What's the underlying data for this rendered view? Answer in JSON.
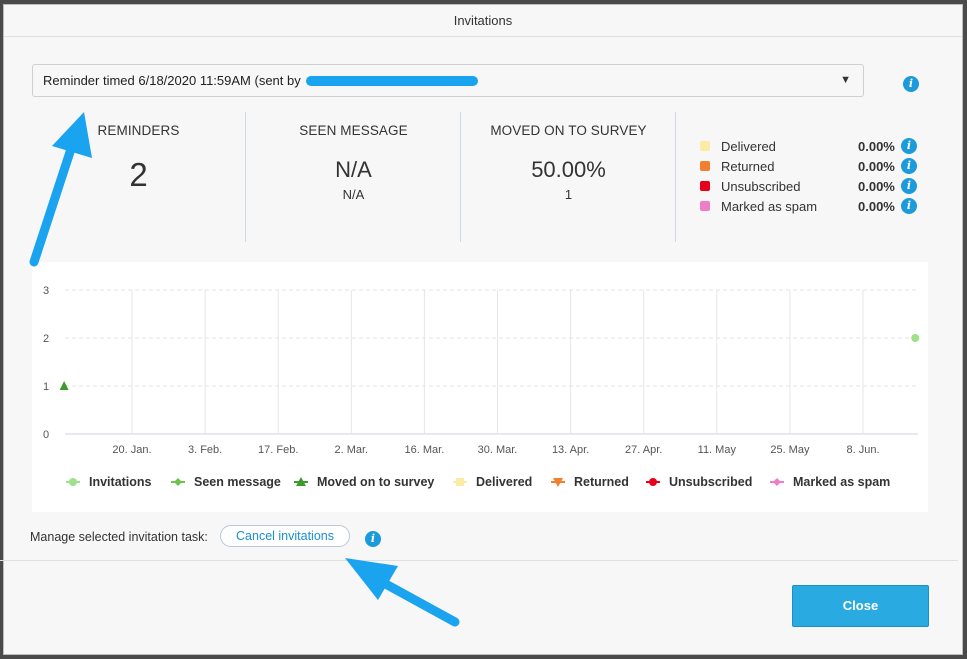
{
  "dialog": {
    "title": "Invitations"
  },
  "reminder_select": {
    "selected_prefix": "Reminder timed 6/18/2020 11:59AM (sent by"
  },
  "stats": {
    "reminders": {
      "label": "REMINDERS",
      "value": "2"
    },
    "seen_message": {
      "label": "SEEN MESSAGE",
      "value": "N/A",
      "sub": "N/A"
    },
    "moved_on": {
      "label": "MOVED ON TO SURVEY",
      "value": "50.00%",
      "sub": "1"
    }
  },
  "status_legend": [
    {
      "label": "Delivered",
      "pct": "0.00%",
      "color": "#fbeba6"
    },
    {
      "label": "Returned",
      "pct": "0.00%",
      "color": "#f07f2f"
    },
    {
      "label": "Unsubscribed",
      "pct": "0.00%",
      "color": "#e8001c"
    },
    {
      "label": "Marked as spam",
      "pct": "0.00%",
      "color": "#ef7ec9"
    }
  ],
  "chart_data": {
    "type": "line",
    "x_tick_labels": [
      "20. Jan.",
      "3. Feb.",
      "17. Feb.",
      "2. Mar.",
      "16. Mar.",
      "30. Mar.",
      "13. Apr.",
      "27. Apr.",
      "11. May",
      "25. May",
      "8. Jun."
    ],
    "y_ticks": [
      0,
      1,
      2,
      3
    ],
    "ylim": [
      0,
      3
    ],
    "series": [
      {
        "name": "Invitations",
        "color": "#9fe08a",
        "marker": "circle",
        "points": [
          {
            "x": "2020-06-18",
            "y": 2
          }
        ]
      },
      {
        "name": "Seen message",
        "color": "#6cc24a",
        "marker": "diamond",
        "points": []
      },
      {
        "name": "Moved on to survey",
        "color": "#3e9a2f",
        "marker": "triangle",
        "points": [
          {
            "x": "2020-01-07",
            "y": 1
          }
        ]
      },
      {
        "name": "Delivered",
        "color": "#fbeba6",
        "marker": "square",
        "points": []
      },
      {
        "name": "Returned",
        "color": "#f07f2f",
        "marker": "triangle-down",
        "points": []
      },
      {
        "name": "Unsubscribed",
        "color": "#e8001c",
        "marker": "circle",
        "points": []
      },
      {
        "name": "Marked as spam",
        "color": "#ef7ec9",
        "marker": "diamond",
        "points": []
      }
    ]
  },
  "manage": {
    "label": "Manage selected invitation task:",
    "cancel_label": "Cancel invitations"
  },
  "footer": {
    "close_label": "Close"
  },
  "colors": {
    "accent": "#29abe2",
    "annotation_arrow": "#1aa3ee"
  }
}
